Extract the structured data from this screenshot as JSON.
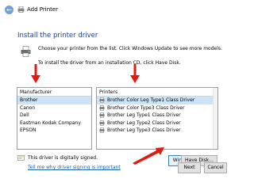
{
  "window": {
    "title": "Add Printer",
    "back_icon": "back-arrow-icon",
    "printer_icon": "printer-icon"
  },
  "heading": "Install the printer driver",
  "instructions": {
    "line1": "Choose your printer from the list. Click Windows Update to see more models.",
    "line2": "To install the driver from an installation CD, click Have Disk."
  },
  "manufacturer": {
    "header": "Manufacturer",
    "items": [
      "Brother",
      "Canon",
      "Dell",
      "Eastman Kodak Company",
      "EPSON"
    ],
    "selected": 0
  },
  "printers": {
    "header": "Printers",
    "items": [
      "Brother Color Leg Type1 Class Driver",
      "Brother Color Type3 Class Driver",
      "Brother Leg Type1 Class Driver",
      "Brother Leg Type2 Class Driver",
      "Brother Leg Type3 Class Driver"
    ],
    "selected": 0
  },
  "signed": {
    "text": "This driver is digitally signed.",
    "link": "Tell me why driver signing is important"
  },
  "buttons": {
    "windows_update": "Windows Update",
    "have_disk": "Have Disk...",
    "next": "Next",
    "cancel": "Cancel"
  },
  "colors": {
    "heading": "#1f3f8a",
    "arrow": "#e01b0f",
    "link": "#1a5fb4",
    "selection": "#cde4f7"
  }
}
